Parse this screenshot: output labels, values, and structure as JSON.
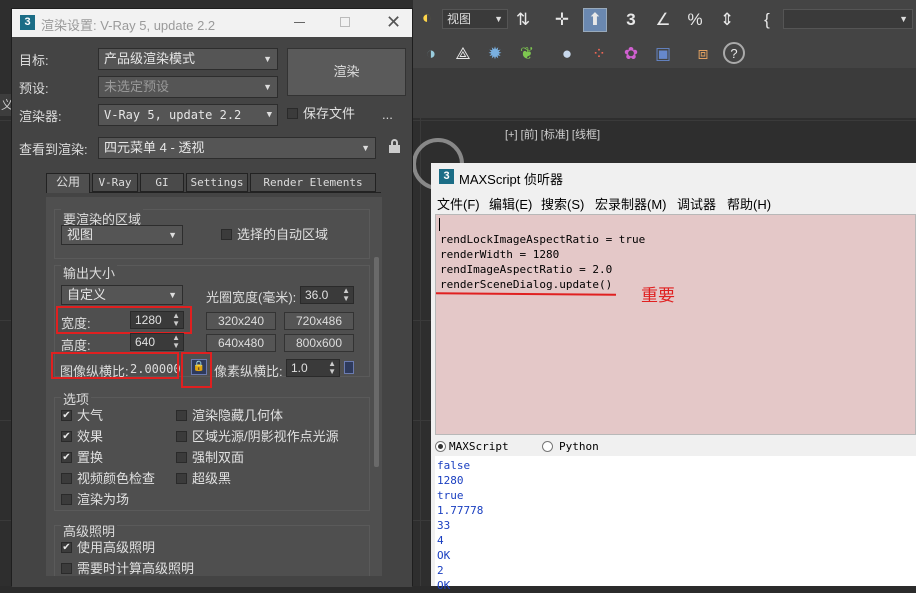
{
  "viewport": {
    "label": "[+] [前] [标准] [线框]",
    "side_char": "义"
  },
  "toolbar": {
    "view_dropdown": "视图",
    "icons": [
      "snap-toggle-icon",
      "move-icon",
      "select-arrow-icon",
      "snap-3d-icon",
      "angle-snap-icon",
      "percent-snap-icon",
      "spinner-snap-icon",
      "curly-brace-icon",
      "material-editor-icon",
      "teapot-icon",
      "gear-icon",
      "grass-icon",
      "sphere-icon",
      "color-swatch-icon",
      "render-setup-icon",
      "render-frame-icon",
      "render-icon",
      "help-icon"
    ]
  },
  "render_dialog": {
    "title": "渲染设置: V-Ray 5, update 2.2",
    "target_label": "目标:",
    "target_value": "产品级渲染模式",
    "preset_label": "预设:",
    "preset_value": "未选定预设",
    "renderer_label": "渲染器:",
    "renderer_value": "V-Ray 5, update 2.2",
    "save_file_label": "保存文件",
    "more_label": "...",
    "view_label": "查看到渲染:",
    "view_value": "四元菜单 4 - 透视",
    "render_button": "渲染",
    "tabs": [
      "公用",
      "V-Ray",
      "GI",
      "Settings",
      "Render Elements"
    ],
    "area_group": "要渲染的区域",
    "area_value": "视图",
    "auto_region": "选择的自动区域",
    "output_group": "输出大小",
    "output_preset": "自定义",
    "aperture_label": "光圈宽度(毫米):",
    "aperture_value": "36.0",
    "width_label": "宽度:",
    "width_value": "1280",
    "height_label": "高度:",
    "height_value": "640",
    "preset_buttons": [
      "320x240",
      "720x486",
      "640x480",
      "800x600"
    ],
    "aspect_label": "图像纵横比:",
    "aspect_value": "2.00000",
    "pixel_aspect_label": "像素纵横比:",
    "pixel_aspect_value": "1.0",
    "options_group": "选项",
    "options_left": [
      {
        "label": "大气",
        "checked": true
      },
      {
        "label": "效果",
        "checked": true
      },
      {
        "label": "置换",
        "checked": true
      },
      {
        "label": "视频颜色检查",
        "checked": false
      },
      {
        "label": "渲染为场",
        "checked": false
      }
    ],
    "options_right": [
      {
        "label": "渲染隐藏几何体",
        "checked": false
      },
      {
        "label": "区域光源/阴影视作点光源",
        "checked": false
      },
      {
        "label": "强制双面",
        "checked": false
      },
      {
        "label": "超级黑",
        "checked": false
      }
    ],
    "adv_group": "高级照明",
    "adv_use": "使用高级照明",
    "adv_compute": "需要时计算高级照明"
  },
  "maxscript": {
    "title": "MAXScript 侦听器",
    "menu": [
      "文件(F)",
      "编辑(E)",
      "搜索(S)",
      "宏录制器(M)",
      "调试器",
      "帮助(H)"
    ],
    "code_lines": [
      "rendLockImageAspectRatio = true",
      "renderWidth = 1280",
      "rendImageAspectRatio = 2.0",
      "renderSceneDialog.update()"
    ],
    "annotation": "重要",
    "radio_maxscript": "MAXScript",
    "radio_python": "Python",
    "output_lines": [
      "false",
      "1280",
      "true",
      "1.77778",
      "33",
      "4",
      "OK",
      "2",
      "OK"
    ]
  }
}
